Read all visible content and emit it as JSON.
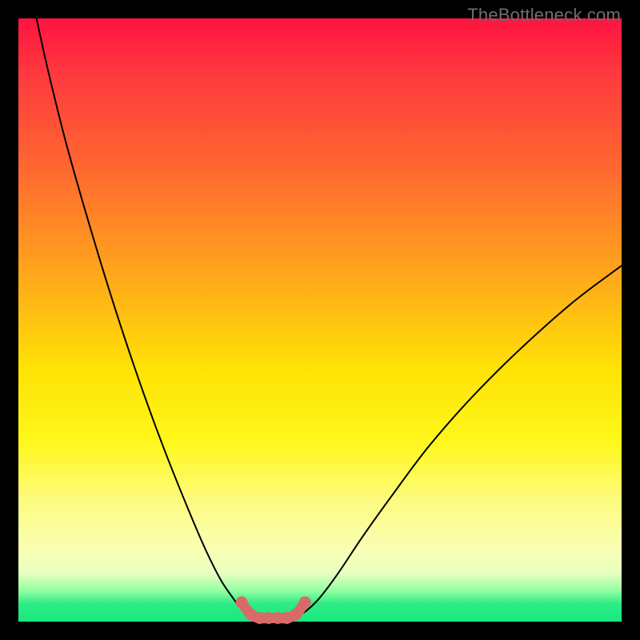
{
  "watermark": "TheBottleneck.com",
  "colors": {
    "background": "#000000",
    "curve": "#000000",
    "highlight": "#d96a6a",
    "gradient_top": "#fe1440",
    "gradient_bottom": "#17e97d"
  },
  "chart_data": {
    "type": "line",
    "title": "",
    "xlabel": "",
    "ylabel": "",
    "xlim": [
      0,
      100
    ],
    "ylim": [
      0,
      100
    ],
    "grid": false,
    "legend": false,
    "series": [
      {
        "name": "left-curve",
        "x": [
          3,
          5,
          8,
          12,
          16,
          20,
          24,
          28,
          31,
          33.5,
          35.5,
          37,
          38.4
        ],
        "y": [
          100,
          91,
          79,
          65,
          52,
          40,
          29,
          19,
          12,
          7,
          4,
          2,
          1
        ]
      },
      {
        "name": "right-curve",
        "x": [
          46.5,
          48,
          50,
          53,
          57,
          62,
          68,
          75,
          83,
          92,
          100
        ],
        "y": [
          1,
          2,
          4,
          8,
          14,
          21,
          29,
          37,
          45,
          53,
          59
        ]
      },
      {
        "name": "flat-bottom-highlight",
        "x": [
          37,
          38.5,
          40,
          41.5,
          43,
          44.5,
          46,
          47.5
        ],
        "y": [
          3.2,
          1.2,
          0.6,
          0.6,
          0.6,
          0.6,
          1.2,
          3.2
        ]
      }
    ],
    "annotations": []
  }
}
